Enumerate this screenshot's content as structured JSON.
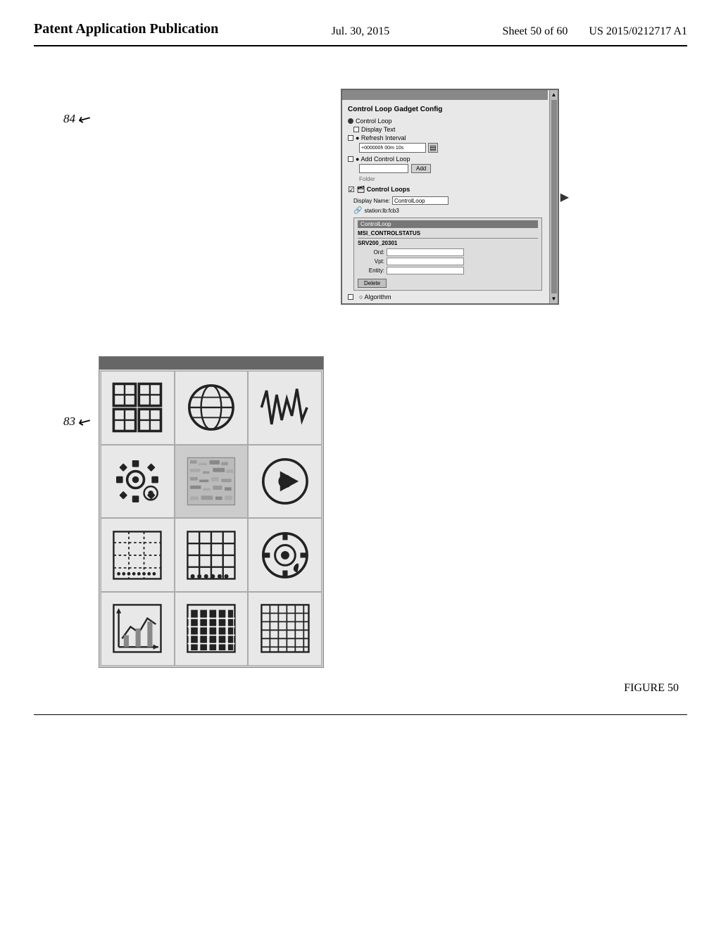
{
  "header": {
    "left": "Patent Application Publication",
    "center": "Jul. 30, 2015",
    "sheet": "Sheet 50 of 60",
    "right": "US 2015/0212717 A1"
  },
  "figure_caption": "FIGURE 50",
  "labels": {
    "label_84": "84",
    "label_83": "83"
  },
  "config_panel": {
    "title": "Control Loop Gadget Config",
    "radio_options": [
      "Control Loop",
      "Display Text",
      "Refresh Interval",
      "Add Control Loop",
      "Control Loops"
    ],
    "control_loop_label": "Control Loop",
    "input_value": "+000000h 00m 10s",
    "add_button": "Add",
    "folder_label": "Folder",
    "display_name_label": "Display Name:",
    "display_name_value": "ControlLoop",
    "station_label": "station:lb:fcb3",
    "inner_popup": {
      "title": "ControlLoop",
      "ord_label": "Ord:",
      "vpt_label": "Vpt:",
      "entity_label": "Entity:",
      "msi_value": "MSI_CONTROLSTATUS",
      "srv_value": "SRV200_20301",
      "delete_button": "Delete"
    },
    "algorithm_label": "Algorithm"
  },
  "gadget_grid": {
    "rows": 4,
    "cols": 3,
    "cells": [
      {
        "icon": "grid4x4",
        "row": 0,
        "col": 0
      },
      {
        "icon": "globe-chart",
        "row": 0,
        "col": 1
      },
      {
        "icon": "waveform",
        "row": 0,
        "col": 2
      },
      {
        "icon": "gear-complex",
        "row": 1,
        "col": 0
      },
      {
        "icon": "image-texture",
        "row": 1,
        "col": 1
      },
      {
        "icon": "play-button",
        "row": 1,
        "col": 2
      },
      {
        "icon": "dotted-grid",
        "row": 2,
        "col": 0
      },
      {
        "icon": "lined-grid",
        "row": 2,
        "col": 1
      },
      {
        "icon": "settings-gear",
        "row": 2,
        "col": 2
      },
      {
        "icon": "chart-mixed",
        "row": 3,
        "col": 0
      },
      {
        "icon": "bar-chart",
        "row": 3,
        "col": 1
      },
      {
        "icon": "grid-dense",
        "row": 3,
        "col": 2
      }
    ]
  }
}
